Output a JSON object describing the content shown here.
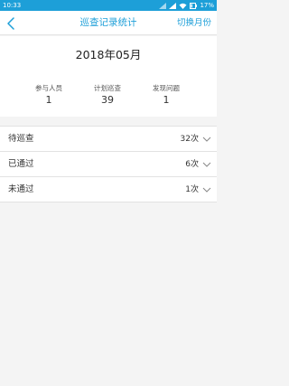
{
  "status_bar": {
    "time": "10:33",
    "battery": "17%"
  },
  "nav": {
    "title": "巡查记录统计",
    "action": "切换月份"
  },
  "summary": {
    "month": "2018年05月",
    "stats": [
      {
        "label": "参与人员",
        "value": "1"
      },
      {
        "label": "计划巡查",
        "value": "39"
      },
      {
        "label": "发现问题",
        "value": "1"
      }
    ]
  },
  "list": {
    "rows": [
      {
        "label": "待巡查",
        "count": "32次"
      },
      {
        "label": "已通过",
        "count": "6次"
      },
      {
        "label": "未通过",
        "count": "1次"
      }
    ]
  },
  "theme": {
    "accent": "#1d9fd8",
    "status_bar": "#1d9fd8",
    "background": "#f4f4f4"
  },
  "icons": [
    "back-arrow-icon",
    "chevron-down-icon",
    "signal-icon",
    "wifi-icon",
    "battery-icon"
  ]
}
